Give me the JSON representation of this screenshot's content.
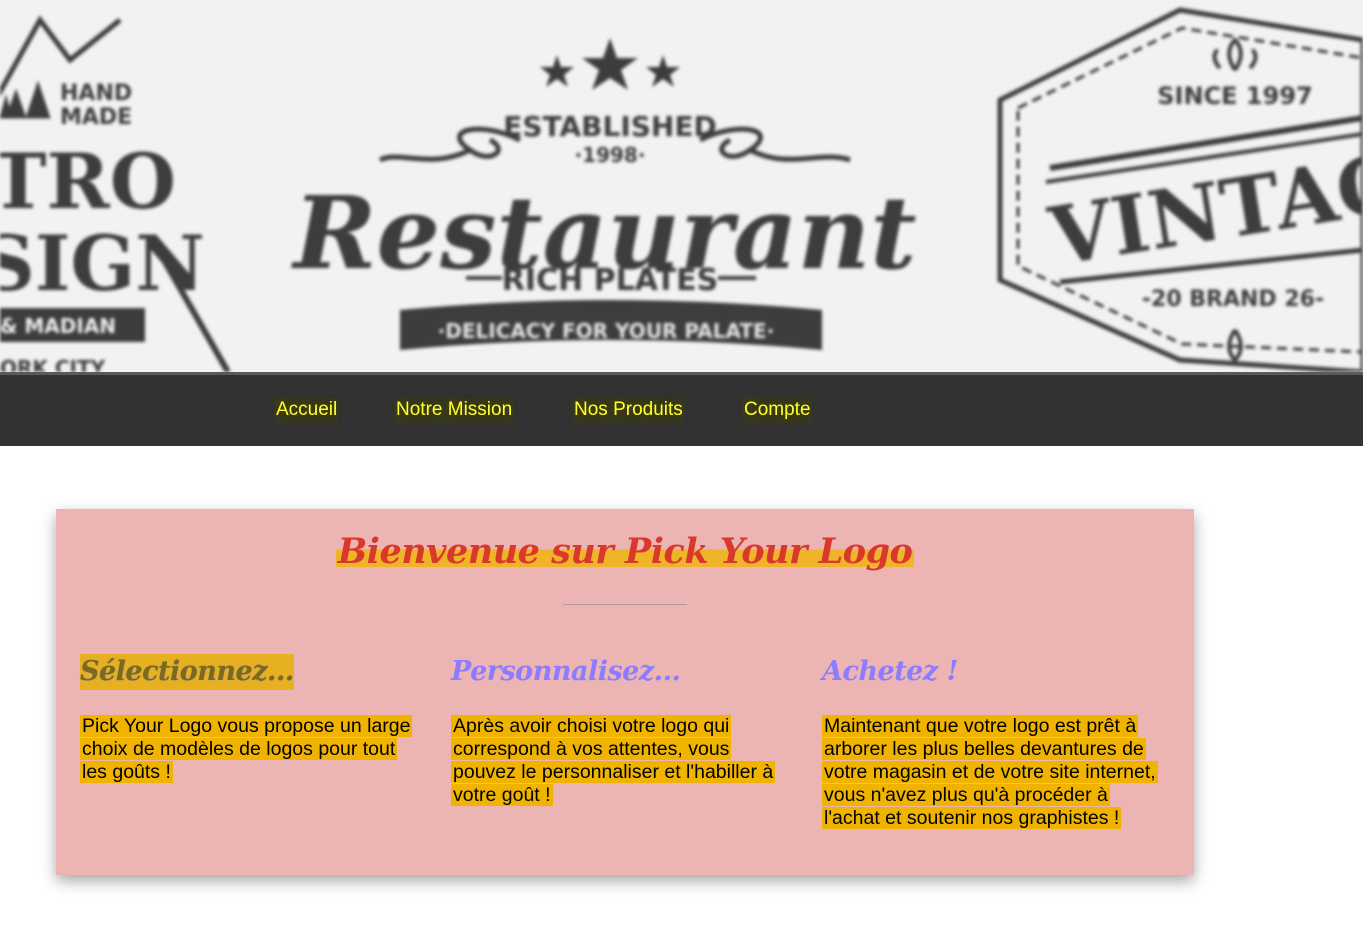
{
  "banner": {
    "logos": {
      "left": {
        "line1": "HAND",
        "line2": "MADE",
        "big1": "TRO",
        "big2": "SIGN",
        "ribbon": "& MADIAN",
        "bottom": "ORK CITY"
      },
      "center": {
        "established": "ESTABLISHED",
        "year": "·1998·",
        "name": "Restaurant",
        "sub": "RICH PLATES",
        "ribbon": "·DELICACY FOR YOUR PALATE·"
      },
      "right": {
        "since": "SINCE 1997",
        "name": "VINTAGE",
        "sub": "-20 BRAND 26-"
      }
    }
  },
  "nav": {
    "items": [
      {
        "label": "Accueil"
      },
      {
        "label": "Notre Mission"
      },
      {
        "label": "Nos Produits"
      },
      {
        "label": "Compte"
      }
    ]
  },
  "main": {
    "welcome": "Bienvenue sur Pick Your Logo",
    "columns": [
      {
        "title": "Sélectionnez...",
        "text": "Pick Your Logo vous propose un large choix de modèles de logos pour tout les goûts !"
      },
      {
        "title": "Personnalisez...",
        "text": "Après avoir choisi votre logo qui correspond à vos attentes, vous pouvez le personnaliser et l'habiller à votre goût !"
      },
      {
        "title": "Achetez !",
        "text": "Maintenant que votre logo est prêt à arborer les plus belles devantures de votre magasin et de votre site internet, vous n'avez plus qu'à procéder à l'achat et soutenir nos graphistes !"
      }
    ]
  },
  "colors": {
    "nav_bg": "#333333",
    "nav_text": "#ffff33",
    "card_bg": "#edb4b4",
    "welcome_text": "#d9382c",
    "highlight": "#f0b400",
    "column_title": "#8c7cff"
  }
}
